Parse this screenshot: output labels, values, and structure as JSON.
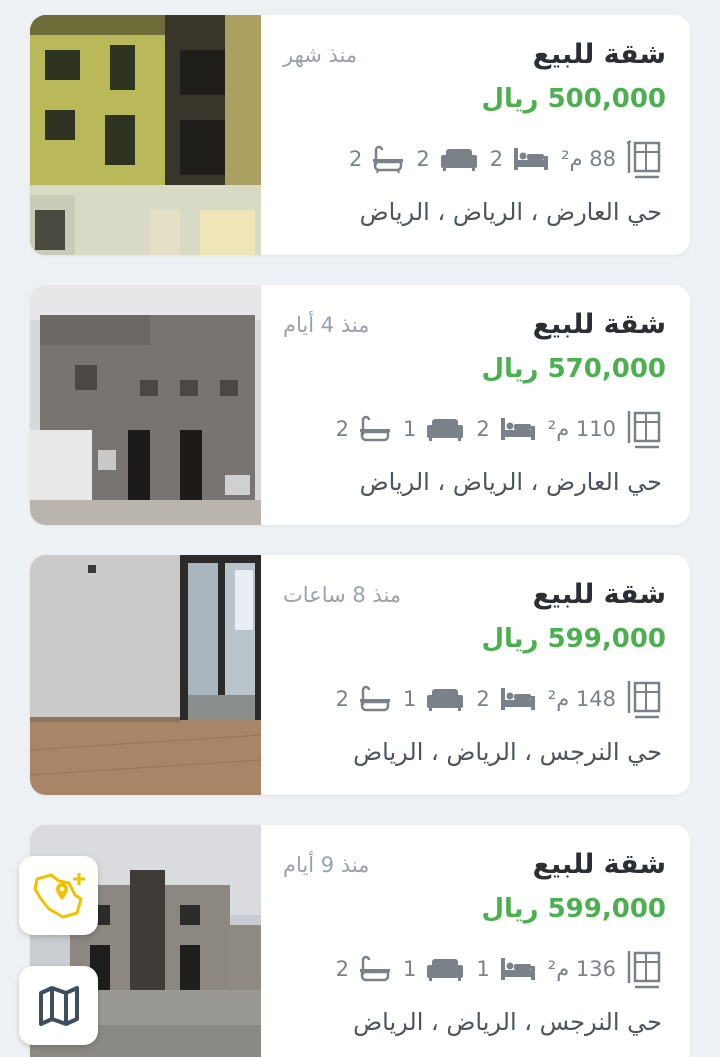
{
  "listings": [
    {
      "title": "شقة للبيع",
      "price": "500,000 ريال",
      "time": "منذ شهر",
      "area": "88 م²",
      "bedrooms": "2",
      "livingrooms": "2",
      "bathrooms": "2",
      "location": "حي العارض ، الرياض ، الرياض",
      "photo_icon": "building-exterior-photo"
    },
    {
      "title": "شقة للبيع",
      "price": "570,000 ريال",
      "time": "منذ 4 أيام",
      "area": "110 م²",
      "bedrooms": "2",
      "livingrooms": "1",
      "bathrooms": "2",
      "location": "حي العارض ، الرياض ، الرياض",
      "photo_icon": "building-exterior-photo"
    },
    {
      "title": "شقة للبيع",
      "price": "599,000 ريال",
      "time": "منذ 8 ساعات",
      "area": "148 م²",
      "bedrooms": "2",
      "livingrooms": "1",
      "bathrooms": "2",
      "location": "حي النرجس ، الرياض ، الرياض",
      "photo_icon": "interior-room-photo"
    },
    {
      "title": "شقة للبيع",
      "price": "599,000 ريال",
      "time": "منذ 9 أيام",
      "area": "136 م²",
      "bedrooms": "1",
      "livingrooms": "1",
      "bathrooms": "2",
      "location": "حي النرجس ، الرياض ، الرياض",
      "photo_icon": "building-exterior-photo"
    }
  ],
  "colors": {
    "price_green": "#4caf50",
    "background": "#eef1f4",
    "card": "#ffffff",
    "fab_icon_yellow": "#f2c200"
  },
  "fabs": {
    "location_icon": "saudi-map-add-location-icon",
    "map_icon": "folded-map-icon"
  }
}
